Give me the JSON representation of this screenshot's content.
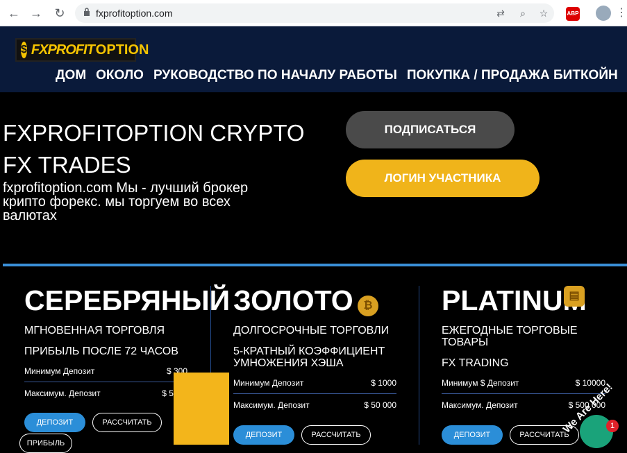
{
  "browser": {
    "url": "fxprofitoption.com",
    "abp_label": "ABP"
  },
  "header": {
    "logo_dollar": "$",
    "logo_part1": "FXPROFIT",
    "logo_part2": "OPTION",
    "nav": [
      "ДОМ",
      "ОКОЛО",
      "РУКОВОДСТВО ПО НАЧАЛУ РАБОТЫ",
      "ПОКУПКА / ПРОДАЖА БИТКОЙН"
    ]
  },
  "hero": {
    "title_line1": "FXPROFITOPTION CRYPTO",
    "title_line2": "FX TRADES",
    "subtitle": "fxprofitoption.com Мы - лучший брокер крипто форекс. мы торгуем во всех валютах",
    "subscribe_label": "ПОДПИСАТЬСЯ",
    "login_label": "ЛОГИН УЧАСТНИКА"
  },
  "plans": [
    {
      "title": "СЕРЕБРЯНЫЙ",
      "features": [
        "МГНОВЕННАЯ ТОРГОВЛЯ",
        "ПРИБЫЛЬ ПОСЛЕ 72 ЧАСОВ"
      ],
      "rows": [
        {
          "label": "Минимум Депозит",
          "value": "$ 300"
        },
        {
          "label": "Максимум. Депозит",
          "value": "$ 5000"
        }
      ],
      "deposit_label": "ДЕПОЗИТ",
      "calc_label": "РАССЧИТАТЬ",
      "extra_label": "ПРИБЫЛЬ"
    },
    {
      "title": "ЗОЛОТО",
      "features": [
        "ДОЛГОСРОЧНЫЕ ТОРГОВЛИ",
        "5-КРАТНЫЙ КОЭФФИЦИЕНТ",
        "УМНОЖЕНИЯ ХЭША"
      ],
      "rows": [
        {
          "label": "Минимум Депозит",
          "value": "$ 1000"
        },
        {
          "label": "Максимум. Депозит",
          "value": "$ 50 000"
        }
      ],
      "deposit_label": "ДЕПОЗИТ",
      "calc_label": "РАССЧИТАТЬ"
    },
    {
      "title": "PLATINUM",
      "features": [
        "ЕЖЕГОДНЫЕ ТОРГОВЫЕ",
        "ТОВАРЫ",
        "FX TRADING"
      ],
      "rows": [
        {
          "label": "Минимум $ Депозит",
          "value": "$ 10000"
        },
        {
          "label": "Максимум. Депозит",
          "value": "$ 500 000"
        }
      ],
      "deposit_label": "ДЕПОЗИТ",
      "calc_label": "РАССЧИТАТЬ"
    }
  ],
  "chat": {
    "badge": "1",
    "banner": "We Are Here!"
  }
}
